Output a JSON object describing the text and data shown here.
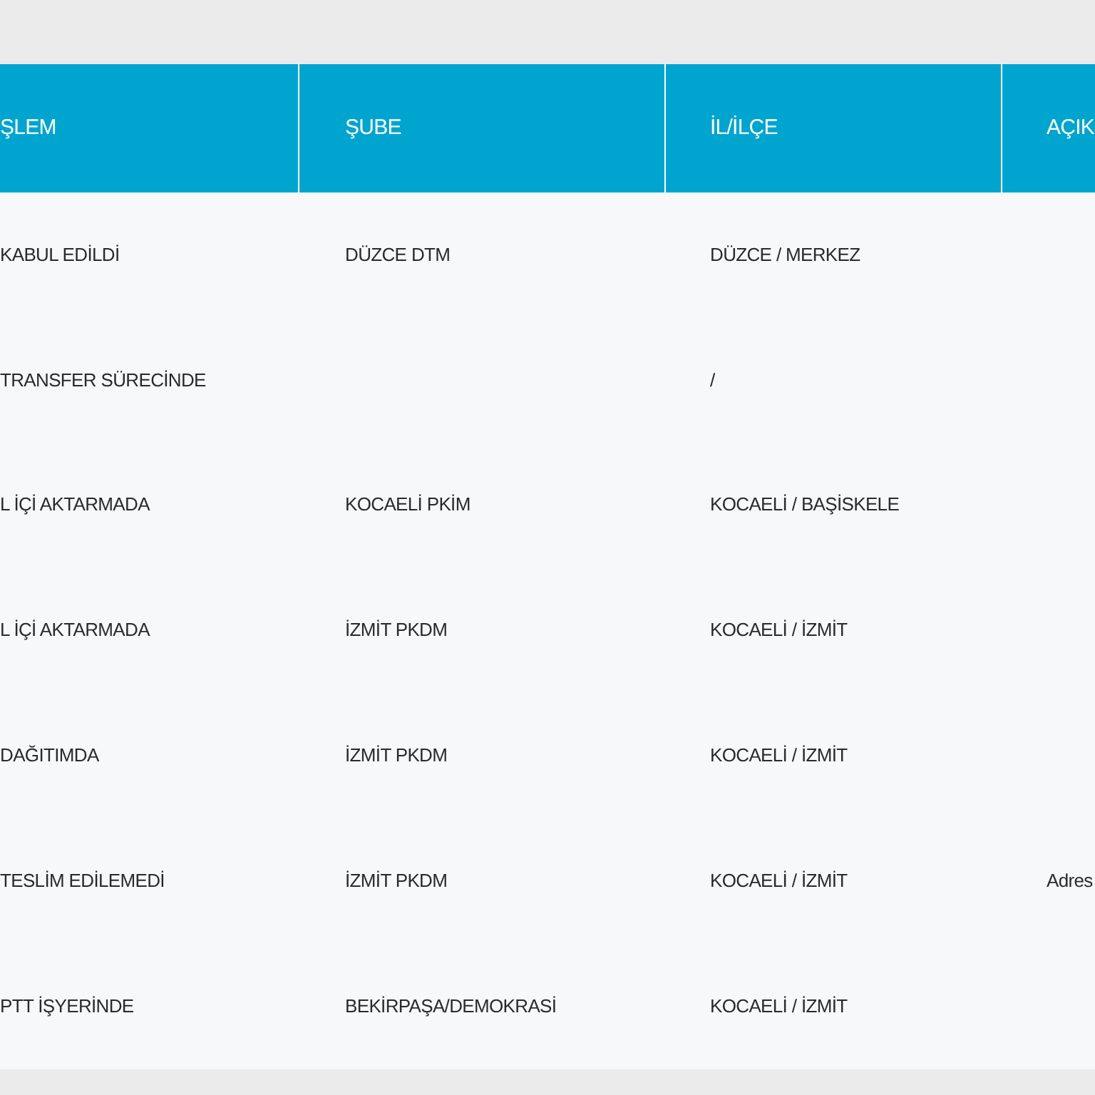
{
  "table": {
    "columns": [
      "ŞLEM",
      "ŞUBE",
      "İL/İLÇE",
      "AÇIK"
    ],
    "rows": [
      {
        "column_1": "KABUL EDİLDİ",
        "column_2": "DÜZCE DTM",
        "column_3": "DÜZCE / MERKEZ"
      },
      {
        "column_1": "TRANSFER SÜRECİNDE",
        "column_3": "/"
      },
      {
        "column_1": "L İÇİ AKTARMADA",
        "column_2": "KOCAELİ PKİM",
        "column_3": "KOCAELİ / BAŞİSKELE"
      },
      {
        "column_1": "L İÇİ AKTARMADA",
        "column_2": "İZMİT PKDM",
        "column_3": "KOCAELİ / İZMİT"
      },
      {
        "column_1": "DAĞITIMDA",
        "column_2": "İZMİT PKDM",
        "column_3": "KOCAELİ / İZMİT"
      },
      {
        "column_1": "TESLİM EDİLEMEDİ",
        "column_2": "İZMİT PKDM",
        "column_3": "KOCAELİ / İZMİT",
        "column_4": "Adres"
      },
      {
        "column_1": "PTT İŞYERİNDE",
        "column_2": "BEKİRPAŞA/DEMOKRASİ",
        "column_3": "KOCAELİ / İZMİT"
      }
    ]
  }
}
